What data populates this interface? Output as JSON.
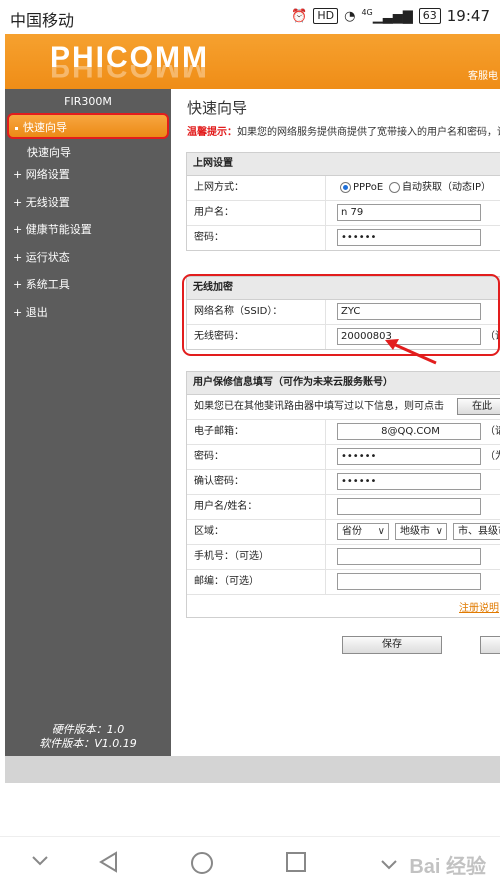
{
  "statusbar": {
    "carrier": "中国移动",
    "hd": "HD",
    "signal": "4G",
    "battery": "63",
    "time": "19:47"
  },
  "header": {
    "logo": "PHICOMM",
    "link": "客服电"
  },
  "sidebar": {
    "model": "FIR300M",
    "items": [
      {
        "label": "快速向导"
      },
      {
        "label": "快速向导"
      },
      {
        "label": "网络设置"
      },
      {
        "label": "无线设置"
      },
      {
        "label": "健康节能设置"
      },
      {
        "label": "运行状态"
      },
      {
        "label": "系统工具"
      },
      {
        "label": "退出"
      }
    ],
    "hardware_version": "硬件版本：1.0",
    "software_version": "软件版本：V1.0.19"
  },
  "main": {
    "title": "快速向导",
    "tip_label": "温馨提示：",
    "tip_text": "如果您的网络服务提供商提供了宽带接入的用户名和密码，请",
    "internet": {
      "heading": "上网设置",
      "mode_label": "上网方式：",
      "mode_options": [
        "PPPoE",
        "自动获取（动态IP）"
      ],
      "username_label": "用户名：",
      "username_value": "n               79",
      "password_label": "密码：",
      "password_value": "••••••"
    },
    "wireless": {
      "heading": "无线加密",
      "ssid_label": "网络名称（SSID）：",
      "ssid_value": "ZYC",
      "password_label": "无线密码：",
      "password_value": "20000803",
      "hint": "（请"
    },
    "register": {
      "heading": "用户保修信息填写（可作为未来云服务账号）",
      "note": "如果您已在其他斐讯路由器中填写过以下信息，则可点击",
      "note_button": "在此",
      "email_label": "电子邮箱：",
      "email_value": "8@QQ.COM",
      "email_hint": "（请",
      "password_label": "密码：",
      "password_value": "••••••",
      "password_hint": "（为",
      "confirm_label": "确认密码：",
      "confirm_value": "••••••",
      "name_label": "用户名/姓名：",
      "name_value": "",
      "region_label": "区域：",
      "province": "省份",
      "city": "地级市",
      "county": "市、县级市",
      "phone_label": "手机号：（可选）",
      "phone_value": "",
      "zip_label": "邮编：（可选）",
      "zip_value": "",
      "register_link": "注册说明"
    },
    "save_button": "保存"
  },
  "watermark": "Bai 经验",
  "colors": {
    "brand_orange": "#ef8d17",
    "sidebar_gray": "#5c5c5c",
    "annotation_red": "#e21d1d"
  }
}
